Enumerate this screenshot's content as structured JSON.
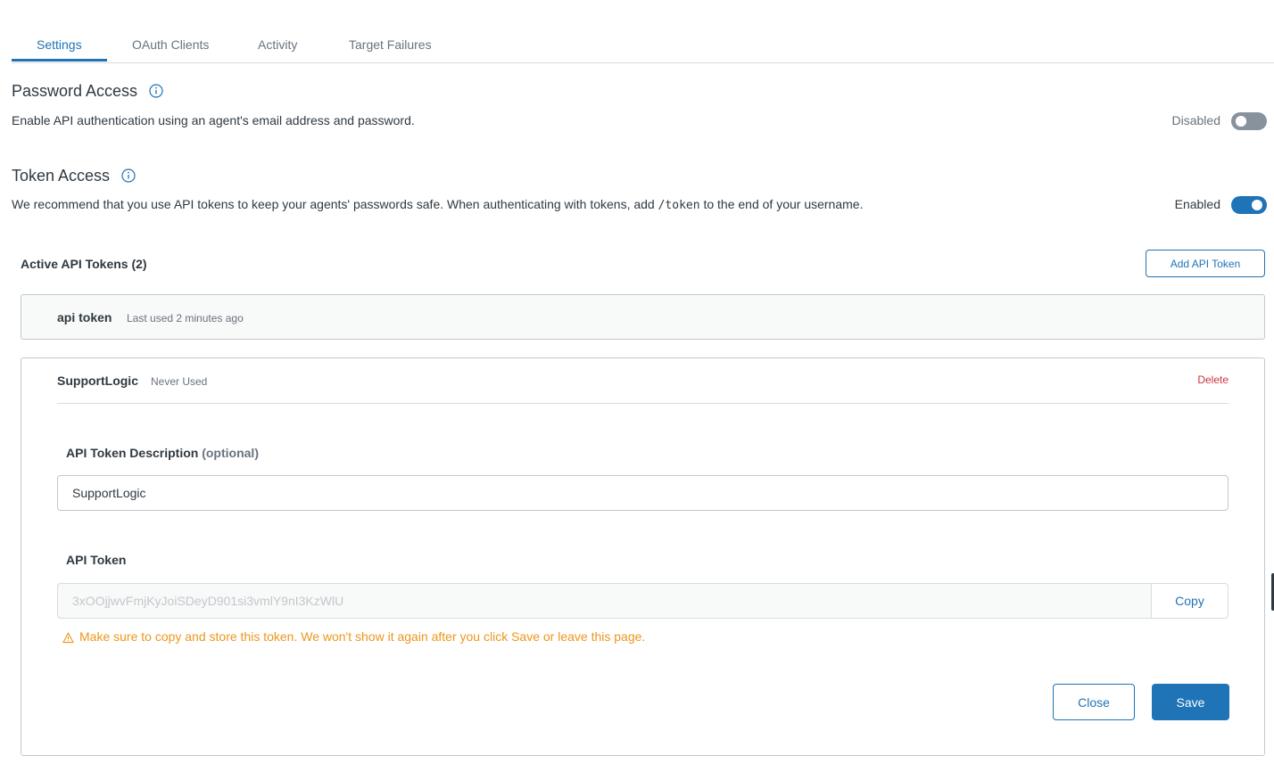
{
  "tabs": [
    {
      "label": "Settings",
      "active": true
    },
    {
      "label": "OAuth Clients",
      "active": false
    },
    {
      "label": "Activity",
      "active": false
    },
    {
      "label": "Target Failures",
      "active": false
    }
  ],
  "password_access": {
    "title": "Password Access",
    "description": "Enable API authentication using an agent's email address and password.",
    "status_label": "Disabled",
    "enabled": false
  },
  "token_access": {
    "title": "Token Access",
    "description_before": "We recommend that you use API tokens to keep your agents' passwords safe. When authenticating with tokens, add ",
    "description_code": "/token",
    "description_after": " to the end of your username.",
    "status_label": "Enabled",
    "enabled": true
  },
  "active_tokens": {
    "heading": "Active API Tokens (2)",
    "add_button": "Add API Token",
    "tokens": [
      {
        "name": "api token",
        "meta": "Last used 2 minutes ago"
      },
      {
        "name": "SupportLogic",
        "meta": "Never Used"
      }
    ]
  },
  "token_editor": {
    "delete_label": "Delete",
    "description_label": "API Token Description",
    "description_optional": "(optional)",
    "description_value": "SupportLogic",
    "token_label": "API Token",
    "token_value": "3xOOjjwvFmjKyJoiSDeyD901si3vmlY9nI3KzWlU",
    "copy_label": "Copy",
    "warning": "Make sure to copy and store this token. We won't show it again after you click Save or leave this page.",
    "close_label": "Close",
    "save_label": "Save"
  },
  "colors": {
    "accent": "#1f73b7",
    "danger": "#cc3340",
    "warning": "#ed961c",
    "toggle_off": "#87929d"
  },
  "icons": {
    "info": "info-circle-icon",
    "warning": "warning-triangle-icon"
  }
}
